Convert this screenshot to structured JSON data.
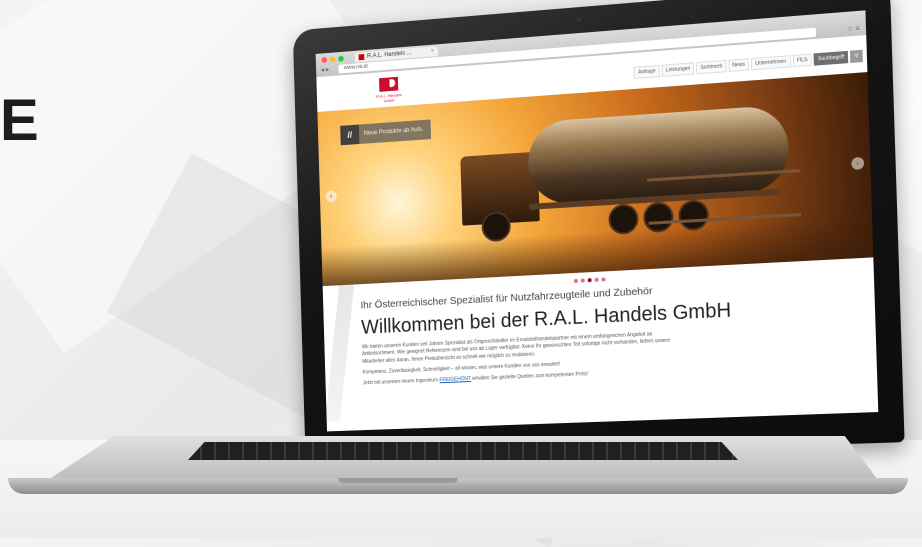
{
  "background": {
    "side_text": "E"
  },
  "browser": {
    "tab_title": "R.A.L. Handels ...",
    "tab_close": "×",
    "url": "www.ral.at",
    "nav_back": "◂",
    "nav_forward": "▸",
    "right_controls": "☆  ≡",
    "traffic_lights": [
      "#ff5f57",
      "#febc2e",
      "#28c840"
    ]
  },
  "site": {
    "logo_name": "R.A.L. Handels GmbH",
    "menu": [
      "Anfrage",
      "Leistungen",
      "Sortiment",
      "News",
      "Unternehmen",
      "FILS"
    ],
    "menu_search": "Suchbegriff",
    "brand_color": "#c8102e"
  },
  "hero": {
    "badge_text": "Neue Produkte ab Aufs.",
    "badge_icon": "//",
    "prev_arrow": "‹",
    "next_arrow": "›",
    "active_slide": 2,
    "slide_count": 5
  },
  "content": {
    "subtitle": "Ihr Österreichischer Spezialist für Nutzfahrzeugteile und Zubehör",
    "title": "Willkommen bei der R.A.L. Handels GmbH",
    "paragraph1": "Wir bieten unseren Kunden seit Jahren Spezialist als Ortgrosshändler im Ersatzteilhandelspartner mit einem umfangreichen Angebot an Artikelsortiment. Wie geeignet Referenzen sind bei uns ab Lager verfügbar. Keine Ihr gewünschtes Teil sofortige nicht vorhanden, liefern unsere Mitarbeiter alles daran, Ihnen Preisübersicht so schnell wie möglich zu realisieren.",
    "paragraph2": "Kompetenz, Zuverlässigkeit, Schnelligkeit – all wissen, was unsere Kunden von uns erwartet!",
    "paragraph3_before": "Jetzt mit unserem neuen Ingenieurs-",
    "paragraph3_link": "FREIGEHÖNT",
    "paragraph3_after": " erhalten Sie gezielte Quellen zum kompetenten Preis!"
  }
}
